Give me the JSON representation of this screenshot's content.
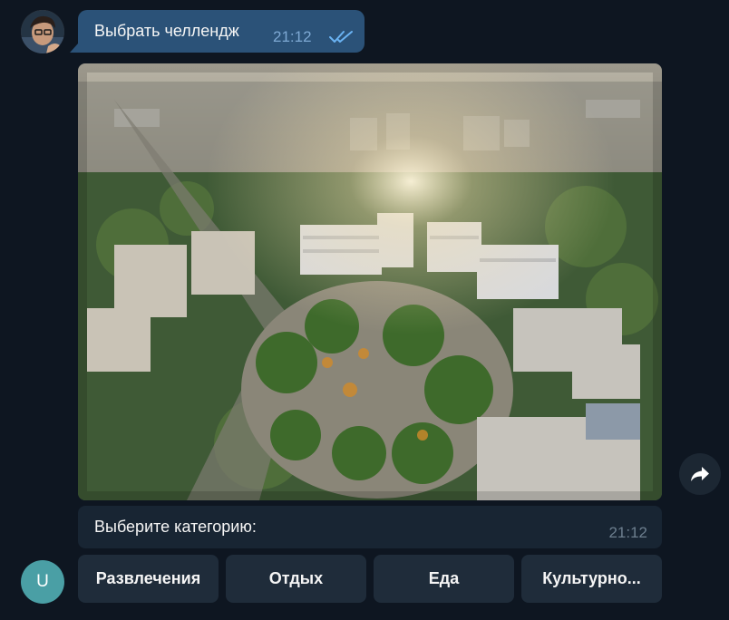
{
  "messages": {
    "outgoing": {
      "text": "Выбрать челлендж",
      "time": "21:12",
      "status_icon": "double-check-icon"
    },
    "photo": {
      "kind": "aerial-city-square-photo"
    },
    "incoming": {
      "text": "Выберите категорию:",
      "time": "21:12"
    }
  },
  "bot_avatar": {
    "letter": "U",
    "color": "#4a9fa5"
  },
  "keyboard": {
    "buttons": [
      "Развлечения",
      "Отдых",
      "Еда",
      "Культурно..."
    ]
  },
  "icons": {
    "forward": "forward-arrow-icon"
  },
  "colors": {
    "background": "#0e1621",
    "outgoing_bubble": "#2b5278",
    "incoming_bubble": "#182533",
    "keyboard_button": "#1f2c3a",
    "read_check": "#6ab3f3"
  }
}
